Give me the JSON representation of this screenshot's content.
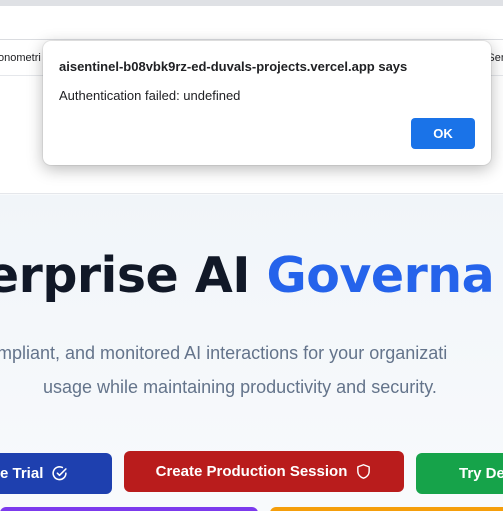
{
  "browser": {
    "bookmarks_left": "onometri",
    "bookmarks_right": "Sen"
  },
  "hero": {
    "title_prefix": "terprise AI ",
    "title_accent": "Governa",
    "subtitle_line1": "mpliant, and monitored AI interactions for your organizati",
    "subtitle_line2": "usage while maintaining productivity and security."
  },
  "buttons": {
    "trial_label": "e Trial",
    "production_label": "Create Production Session",
    "demo_label": "Try De"
  },
  "dialog": {
    "title": "aisentinel-b08vbk9rz-ed-duvals-projects.vercel.app says",
    "message": "Authentication failed: undefined",
    "ok_label": "OK"
  },
  "colors": {
    "accent_blue": "#2563eb",
    "trial_button": "#1e40af",
    "production_button": "#b91c1c",
    "demo_button": "#16a34a",
    "dialog_ok": "#1a73e8"
  },
  "icons": {
    "trial": "check-circle-icon",
    "production": "shield-icon"
  }
}
